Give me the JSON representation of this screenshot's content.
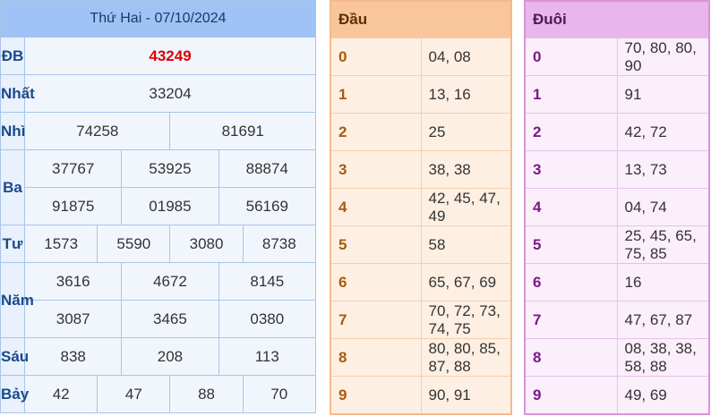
{
  "results": {
    "header": "Thứ Hai - 07/10/2024",
    "db_label": "ĐB",
    "db_value": "43249",
    "nhat_label": "Nhất",
    "nhat_value": "33204",
    "nhi_label": "Nhì",
    "nhi_values": [
      "74258",
      "81691"
    ],
    "ba_label": "Ba",
    "ba_values": [
      "37767",
      "53925",
      "88874",
      "91875",
      "01985",
      "56169"
    ],
    "tu_label": "Tư",
    "tu_values": [
      "1573",
      "5590",
      "3080",
      "8738"
    ],
    "nam_label": "Năm",
    "nam_values": [
      "3616",
      "4672",
      "8145",
      "3087",
      "3465",
      "0380"
    ],
    "sau_label": "Sáu",
    "sau_values": [
      "838",
      "208",
      "113"
    ],
    "bay_label": "Bảy",
    "bay_values": [
      "42",
      "47",
      "88",
      "70"
    ]
  },
  "dau": {
    "header": "Đầu",
    "rows": [
      {
        "digit": "0",
        "values": "04, 08"
      },
      {
        "digit": "1",
        "values": "13, 16"
      },
      {
        "digit": "2",
        "values": "25"
      },
      {
        "digit": "3",
        "values": "38, 38"
      },
      {
        "digit": "4",
        "values": "42, 45, 47, 49"
      },
      {
        "digit": "5",
        "values": "58"
      },
      {
        "digit": "6",
        "values": "65, 67, 69"
      },
      {
        "digit": "7",
        "values": "70, 72, 73, 74, 75"
      },
      {
        "digit": "8",
        "values": "80, 80, 85, 87, 88"
      },
      {
        "digit": "9",
        "values": "90, 91"
      }
    ]
  },
  "duoi": {
    "header": "Đuôi",
    "rows": [
      {
        "digit": "0",
        "values": "70, 80, 80, 90"
      },
      {
        "digit": "1",
        "values": "91"
      },
      {
        "digit": "2",
        "values": "42, 72"
      },
      {
        "digit": "3",
        "values": "13, 73"
      },
      {
        "digit": "4",
        "values": "04, 74"
      },
      {
        "digit": "5",
        "values": "25, 45, 65, 75, 85"
      },
      {
        "digit": "6",
        "values": "16"
      },
      {
        "digit": "7",
        "values": "47, 67, 87"
      },
      {
        "digit": "8",
        "values": "08, 38, 38, 58, 88"
      },
      {
        "digit": "9",
        "values": "49, 69"
      }
    ]
  },
  "colors": {
    "results_header_bg": "#9ec3f4",
    "special_prize": "#e00000",
    "dau_header_bg": "#f9c69c",
    "duoi_header_bg": "#e8b6ea"
  }
}
